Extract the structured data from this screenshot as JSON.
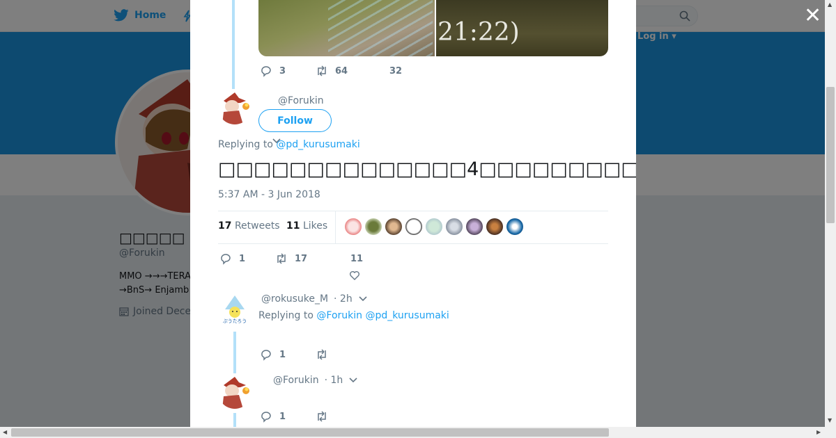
{
  "nav": {
    "home_label": "Home",
    "login_label": "Log in ▾"
  },
  "profile": {
    "name": "□□□□□",
    "handle": "@Forukin",
    "bio": "MMO →→→TERA\n→BnS→ Enjamb",
    "joined": "Joined Dece"
  },
  "modal": {
    "prev_tweet": {
      "image_text": "21:22)",
      "reply_count": "3",
      "retweet_count": "64",
      "like_count": "32"
    },
    "main_tweet": {
      "handle": "@Forukin",
      "follow_label": "Follow",
      "replying_prefix": "Replying to",
      "replying_to": "@pd_kurusumaki",
      "text": "□□□□□□□□□□□□□□4□□□□□□□□□□□□□□□□□□□□□□□□□□□□□□□□□□□□□□□□□□□□□□□",
      "timestamp": "5:37 AM - 3 Jun 2018",
      "retweets_count": "17",
      "retweets_label": "Retweets",
      "likes_count": "11",
      "likes_label": "Likes",
      "reply_count": "1",
      "retweet_count": "17",
      "like_count": "11"
    },
    "replies": [
      {
        "handle": "@rokusuke_M",
        "time": "· 2h",
        "replying_prefix": "Replying to",
        "replying_to_1": "@Forukin",
        "replying_to_2": "@pd_kurusumaki",
        "reply_count": "1"
      },
      {
        "handle": "@Forukin",
        "time": "· 1h",
        "reply_count": "1"
      }
    ]
  },
  "colors": {
    "accent": "#1da1f2",
    "banner": "#1b95e0",
    "muted": "#657786"
  },
  "icons": [
    "twitter-bird-icon",
    "moments-icon",
    "search-icon",
    "close-icon",
    "reply-icon",
    "retweet-icon",
    "heart-icon",
    "chevron-down-icon",
    "calendar-icon"
  ]
}
